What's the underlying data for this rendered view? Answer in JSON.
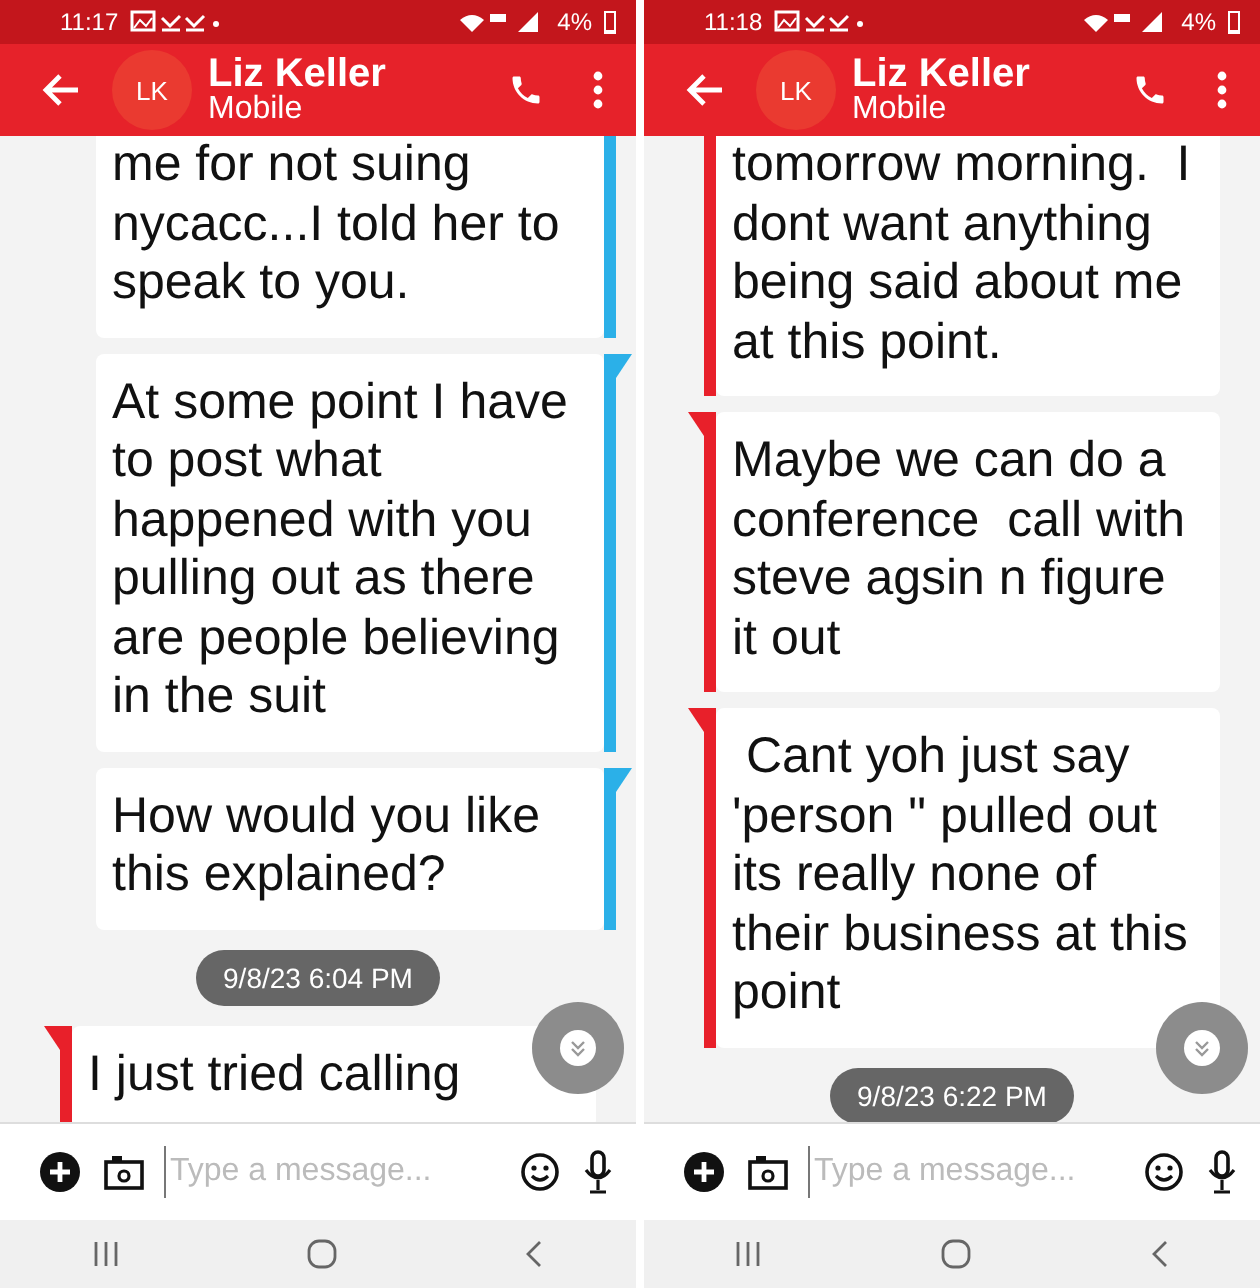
{
  "panels": [
    {
      "status_bar": {
        "time": "11:17",
        "battery": "4%"
      },
      "header": {
        "avatar": "LK",
        "name": "Liz Keller",
        "subtitle": "Mobile"
      },
      "messages": [
        {
          "kind": "sent",
          "cut": true,
          "text": "me for not suing nycacc...I told her to speak to you."
        },
        {
          "kind": "sent",
          "cut": false,
          "text": "At some point I have to post what happened with you pulling out as there are people believing in the suit"
        },
        {
          "kind": "sent",
          "cut": false,
          "text": "How would you like this explained?"
        },
        {
          "kind": "timestamp",
          "text": "9/8/23 6:04 PM"
        },
        {
          "kind": "received",
          "cut": false,
          "text": "I just tried calling"
        }
      ],
      "composer": {
        "placeholder": "Type a message..."
      }
    },
    {
      "status_bar": {
        "time": "11:18",
        "battery": "4%"
      },
      "header": {
        "avatar": "LK",
        "name": "Liz Keller",
        "subtitle": "Mobile"
      },
      "messages": [
        {
          "kind": "received",
          "cut": true,
          "text": "tomorrow morning.  I dont want anything being said about me at this point."
        },
        {
          "kind": "received",
          "cut": false,
          "text": "Maybe we can do a conference  call with steve agsin n figure it out"
        },
        {
          "kind": "received",
          "cut": false,
          "text": " Cant yoh just say 'person \" pulled out its really none of their business at this point"
        },
        {
          "kind": "timestamp",
          "text": "9/8/23 6:22 PM"
        }
      ],
      "composer": {
        "placeholder": "Type a message..."
      }
    }
  ]
}
